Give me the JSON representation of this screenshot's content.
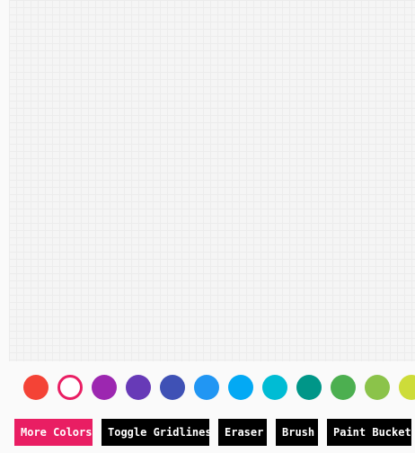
{
  "canvas": {
    "background": "#f5f5f5",
    "gridline_color": "#ececec"
  },
  "palette": {
    "selected_index": 1,
    "colors": [
      {
        "name": "red",
        "hex": "#f44336"
      },
      {
        "name": "pink",
        "hex": "#e91e63"
      },
      {
        "name": "purple",
        "hex": "#9c27b0"
      },
      {
        "name": "deep-purple",
        "hex": "#673ab7"
      },
      {
        "name": "indigo",
        "hex": "#3f51b5"
      },
      {
        "name": "blue",
        "hex": "#2196f3"
      },
      {
        "name": "light-blue",
        "hex": "#03a9f4"
      },
      {
        "name": "cyan",
        "hex": "#00bcd4"
      },
      {
        "name": "teal",
        "hex": "#009688"
      },
      {
        "name": "green",
        "hex": "#4caf50"
      },
      {
        "name": "light-green",
        "hex": "#8bc34a"
      },
      {
        "name": "lime",
        "hex": "#cddc39"
      }
    ]
  },
  "toolbar": {
    "more_colors_label": "More Colors",
    "toggle_gridlines_label": "Toggle Gridlines",
    "eraser_label": "Eraser",
    "brush_label": "Brush",
    "paint_bucket_label": "Paint Bucket",
    "accent_color": "#e91e63",
    "button_color": "#000000"
  }
}
